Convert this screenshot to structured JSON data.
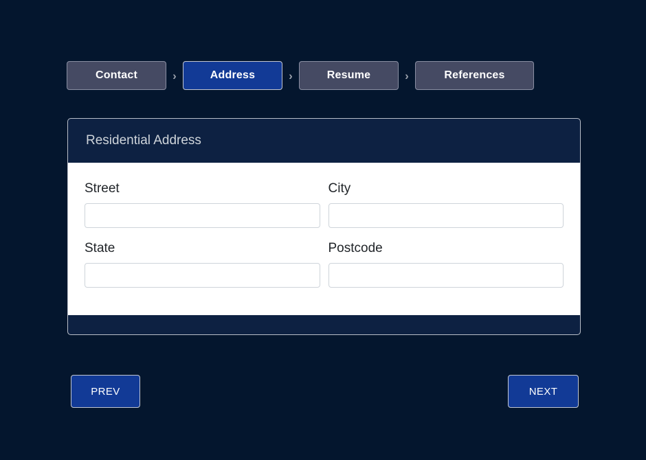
{
  "theme": {
    "page_background": "#04162e",
    "accent_blue": "#123a96",
    "inactive_step": "#454a63",
    "card_header_navy": "#0d2142",
    "input_border": "#ced4da"
  },
  "wizard": {
    "steps": [
      {
        "label": "Contact",
        "active": false
      },
      {
        "label": "Address",
        "active": true
      },
      {
        "label": "Resume",
        "active": false
      },
      {
        "label": "References",
        "active": false
      }
    ],
    "separator_icon": "chevron-right-icon",
    "separator_glyph": "›"
  },
  "card": {
    "title": "Residential Address",
    "fields": [
      {
        "label": "Street",
        "value": "",
        "placeholder": ""
      },
      {
        "label": "City",
        "value": "",
        "placeholder": ""
      },
      {
        "label": "State",
        "value": "",
        "placeholder": ""
      },
      {
        "label": "Postcode",
        "value": "",
        "placeholder": ""
      }
    ]
  },
  "navigation": {
    "prev_label": "PREV",
    "next_label": "NEXT"
  }
}
